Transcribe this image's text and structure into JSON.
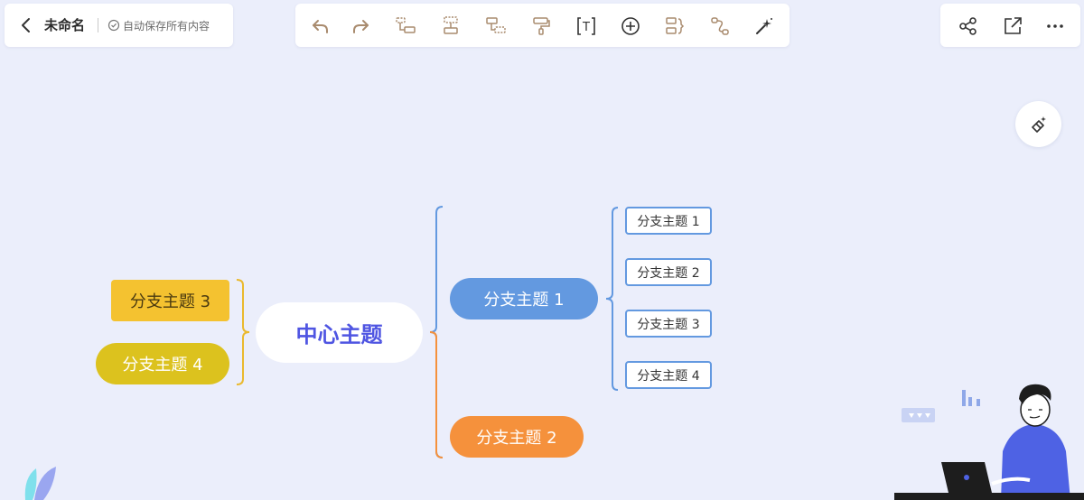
{
  "header": {
    "doc_title": "未命名",
    "autosave_text": "自动保存所有内容"
  },
  "toolbar": {
    "items": [
      {
        "name": "undo"
      },
      {
        "name": "redo"
      },
      {
        "name": "insert-child-topic"
      },
      {
        "name": "insert-sibling-topic"
      },
      {
        "name": "insert-parent-topic"
      },
      {
        "name": "format-painter"
      },
      {
        "name": "text"
      },
      {
        "name": "add"
      },
      {
        "name": "summary"
      },
      {
        "name": "relationship"
      },
      {
        "name": "magic"
      }
    ],
    "text_glyph": "T"
  },
  "mindmap": {
    "central": "中心主题",
    "branches": [
      {
        "label": "分支主题 1",
        "color": "#6399e0"
      },
      {
        "label": "分支主题 2",
        "color": "#f5913c"
      },
      {
        "label": "分支主题 3",
        "color": "#f4c230"
      },
      {
        "label": "分支主题 4",
        "color": "#dcc21e"
      }
    ],
    "subtopics": [
      "分支主题 1",
      "分支主题 2",
      "分支主题 3",
      "分支主题 4"
    ]
  },
  "colors": {
    "background": "#ebeefb",
    "accent": "#4f55e2"
  }
}
